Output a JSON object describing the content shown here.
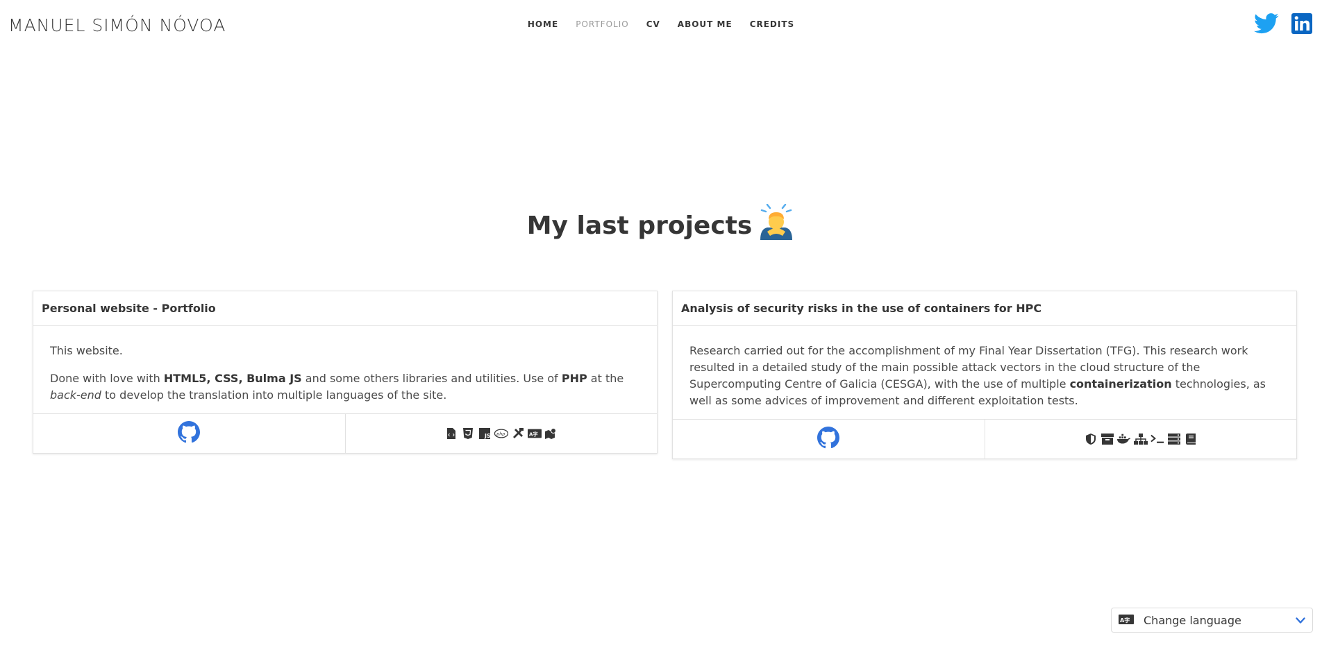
{
  "brand": "MANUEL SIMÓN NÓVOA",
  "nav": {
    "home": "HOME",
    "portfolio": "PORTFOLIO",
    "cv": "CV",
    "about": "ABOUT ME",
    "credits": "CREDITS"
  },
  "social": {
    "twitter_color": "#1da1f2",
    "linkedin_color": "#0a66c2"
  },
  "hero": {
    "title": "My last projects",
    "emoji": "🙇‍♂️"
  },
  "projects": [
    {
      "title": "Personal website - Portfolio",
      "p1": "This website.",
      "p2": {
        "t1": "Done with love with ",
        "b1": "HTML5, CSS, Bulma JS",
        "t2": " and some others libraries and utilities. Use of ",
        "b2": "PHP",
        "t3": " at the ",
        "i1": "back-end",
        "t4": " to develop the translation into multiple languages of the site."
      },
      "link_icon": "github-icon",
      "tech_icons": [
        "file-code-icon",
        "css3-icon",
        "js-icon",
        "php-icon",
        "tools-icon",
        "language-icon",
        "map-icon"
      ]
    },
    {
      "title": "Analysis of security risks in the use of containers for HPC",
      "p": {
        "t1": "Research carried out for the accomplishment of my Final Year Dissertation (TFG). This research work resulted in a detailed study of the main possible attack vectors in the cloud structure of the Supercomputing Centre of Galicia (CESGA), with the use of multiple ",
        "b1": "containerization",
        "t2": " technologies, as well as some advices of improvement and different exploitation tests."
      },
      "link_icon": "github-icon",
      "tech_icons": [
        "shield-icon",
        "box-icon",
        "docker-icon",
        "network-icon",
        "terminal-icon",
        "server-icon",
        "book-icon"
      ]
    }
  ],
  "language_select": {
    "label": "Change language",
    "accent_color": "#3273dc"
  },
  "colors": {
    "github": "#3273dc",
    "text": "#4a4a4a",
    "heading": "#363636"
  }
}
